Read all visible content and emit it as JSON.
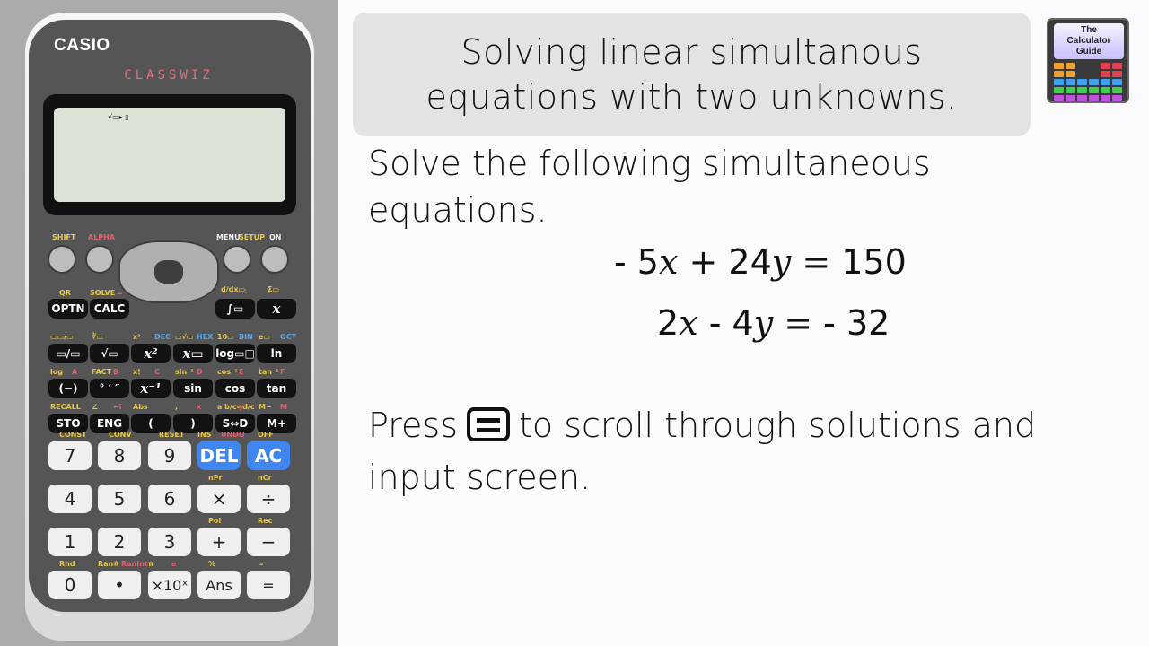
{
  "calculator": {
    "brand": "CASIO",
    "model": "CLASSWIZ",
    "display_indicator": "√▭▸ ▯",
    "top_labels": {
      "shift": "SHIFT",
      "alpha": "ALPHA",
      "menu": "MENU",
      "setup": "SETUP",
      "on": "ON"
    },
    "rows": [
      {
        "keys": [
          {
            "label": "OPTN",
            "shift": "QR"
          },
          {
            "label": "CALC",
            "shift": "SOLVE",
            "alpha": "="
          },
          {
            "label": "∫▭",
            "shift": "d/dx▭",
            "alpha": ":"
          },
          {
            "label": "x",
            "shift": "Σ▭"
          }
        ]
      },
      {
        "keys": [
          {
            "label": "▭/▭",
            "shift": "▭▭/▭"
          },
          {
            "label": "√▭",
            "shift": "∛▭"
          },
          {
            "label": "x²",
            "shift": "x³",
            "alpha": "DEC"
          },
          {
            "label": "x▭",
            "shift": "▭√▭",
            "alpha": "HEX"
          },
          {
            "label": "log▭□",
            "shift": "10▭",
            "alpha": "BIN"
          },
          {
            "label": "ln",
            "shift": "e▭",
            "alpha": "OCT"
          }
        ]
      },
      {
        "keys": [
          {
            "label": "(−)",
            "shift": "log",
            "alpha": "A"
          },
          {
            "label": "° ′ ″",
            "shift": "FACT",
            "alpha": "B"
          },
          {
            "label": "x⁻¹",
            "shift": "x!",
            "alpha": "C"
          },
          {
            "label": "sin",
            "shift": "sin⁻¹",
            "alpha": "D"
          },
          {
            "label": "cos",
            "shift": "cos⁻¹",
            "alpha": "E"
          },
          {
            "label": "tan",
            "shift": "tan⁻¹",
            "alpha": "F"
          }
        ]
      },
      {
        "keys": [
          {
            "label": "STO",
            "shift": "RECALL"
          },
          {
            "label": "ENG",
            "shift": "∠",
            "alpha": "←i"
          },
          {
            "label": "(",
            "shift": "Abs"
          },
          {
            "label": ")",
            "shift": ",",
            "alpha": "x"
          },
          {
            "label": "S⇔D",
            "shift": "a b/c⇔d/c",
            "alpha": "y"
          },
          {
            "label": "M+",
            "shift": "M−",
            "alpha": "M"
          }
        ]
      },
      {
        "keys": [
          {
            "label": "7",
            "shift": "CONST"
          },
          {
            "label": "8",
            "shift": "CONV"
          },
          {
            "label": "9",
            "shift": "RESET"
          },
          {
            "label": "DEL",
            "shift": "INS",
            "alpha": "UNDO"
          },
          {
            "label": "AC",
            "shift": "OFF"
          }
        ]
      },
      {
        "keys": [
          {
            "label": "4"
          },
          {
            "label": "5"
          },
          {
            "label": "6"
          },
          {
            "label": "×",
            "shift": "nPr"
          },
          {
            "label": "÷",
            "shift": "nCr"
          }
        ]
      },
      {
        "keys": [
          {
            "label": "1"
          },
          {
            "label": "2"
          },
          {
            "label": "3"
          },
          {
            "label": "+",
            "shift": "Pol"
          },
          {
            "label": "−",
            "shift": "Rec"
          }
        ]
      },
      {
        "keys": [
          {
            "label": "0",
            "shift": "Rnd"
          },
          {
            "label": "•",
            "shift": "Ran#",
            "alpha": "RanInt"
          },
          {
            "label": "×10ˣ",
            "shift": "π",
            "alpha": "e"
          },
          {
            "label": "Ans",
            "shift": "%"
          },
          {
            "label": "=",
            "shift": "≈"
          }
        ]
      }
    ]
  },
  "header": {
    "title_line1": "Solving linear simultanous",
    "title_line2": "equations with two unknowns.",
    "logo": {
      "line1": "The",
      "line2": "Calculator",
      "line3": "Guide"
    }
  },
  "content": {
    "instruction_line1": "Solve the following simultaneous",
    "instruction_line2": "equations.",
    "equation1": {
      "a": "- 5",
      "b": "+ 24",
      "c": "= 150"
    },
    "equation2": {
      "a": "2",
      "b": "- 4",
      "c": "= - 32"
    },
    "var_x": "x",
    "var_y": "y",
    "press_text_before": "Press",
    "press_text_after": "to scroll through solutions and",
    "press_line2": "input screen."
  }
}
